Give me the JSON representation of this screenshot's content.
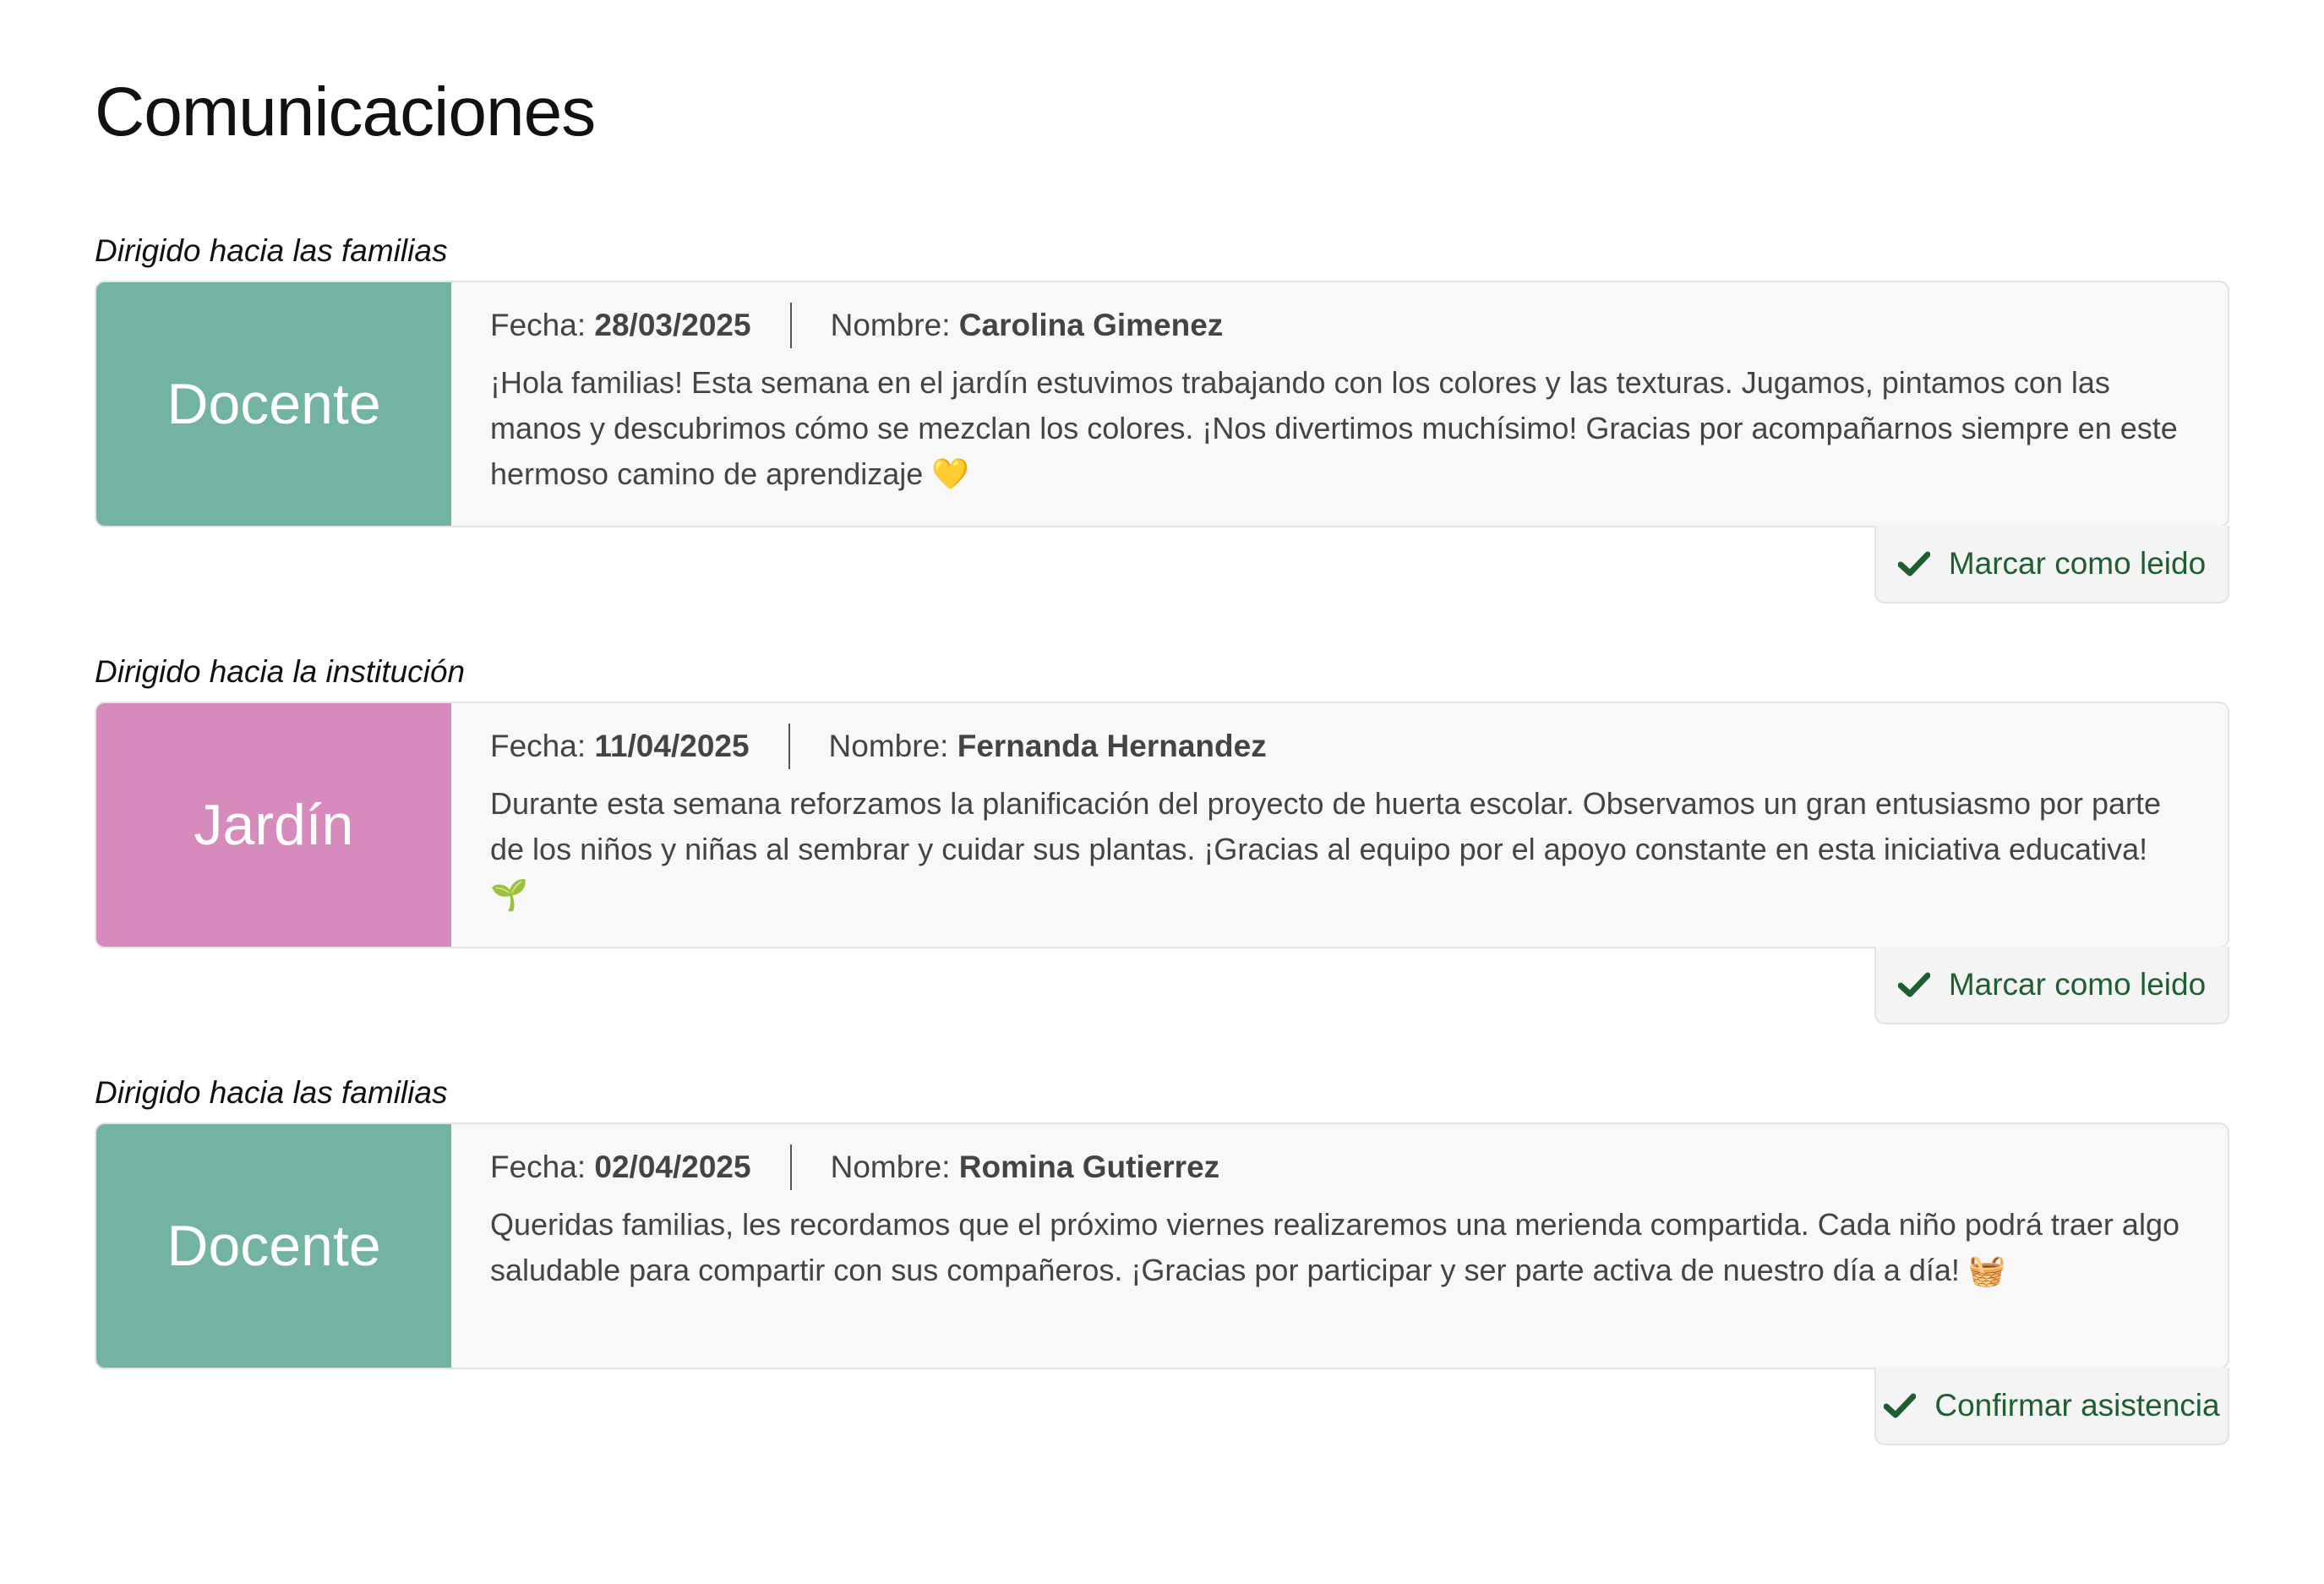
{
  "page": {
    "title": "Comunicaciones"
  },
  "colors": {
    "docente": "#72b3a2",
    "jardin": "#d78bbd",
    "action_text": "#1e5e30"
  },
  "fecha_label": "Fecha:",
  "nombre_label": "Nombre:",
  "communications": [
    {
      "audience": "Dirigido hacia las familias",
      "role": "Docente",
      "fecha": "28/03/2025",
      "nombre": "Carolina Gimenez",
      "message": "¡Hola familias! Esta semana en el jardín estuvimos trabajando con los colores y las texturas. Jugamos, pintamos con las manos y descubrimos cómo se mezclan los colores. ¡Nos divertimos muchísimo! Gracias por acompañarnos siempre en este hermoso camino de aprendizaje 💛",
      "action": "Marcar como leido"
    },
    {
      "audience": "Dirigido hacia la institución",
      "role": "Jardín",
      "fecha": "11/04/2025",
      "nombre": "Fernanda Hernandez",
      "message": "Durante esta semana reforzamos la planificación del proyecto de huerta escolar. Observamos un gran entusiasmo por parte de los niños y niñas al sembrar y cuidar sus plantas. ¡Gracias al equipo por el apoyo constante en esta iniciativa educativa! 🌱",
      "action": "Marcar como leido"
    },
    {
      "audience": "Dirigido hacia las familias",
      "role": "Docente",
      "fecha": "02/04/2025",
      "nombre": "Romina Gutierrez",
      "message": "Queridas familias, les recordamos que el próximo viernes realizaremos una merienda compartida. Cada niño podrá traer algo saludable para compartir con sus compañeros. ¡Gracias por participar y ser parte activa de nuestro día a día! 🧺",
      "action": "Confirmar asistencia"
    }
  ]
}
